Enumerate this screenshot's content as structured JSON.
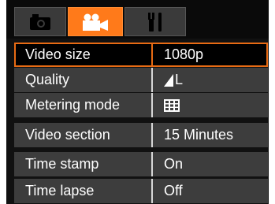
{
  "tabs": [
    {
      "icon": "camera-icon",
      "active": false
    },
    {
      "icon": "video-camera-icon",
      "active": true
    },
    {
      "icon": "tools-icon",
      "active": false
    }
  ],
  "colors": {
    "accent": "#e86b14",
    "active_tab": "#ff7a1a",
    "row_bg": "#3d3d3d",
    "screen_bg": "#111111"
  },
  "menu": {
    "items": [
      {
        "label": "Video size",
        "value": "1080p",
        "selected": true
      },
      {
        "label": "Quality",
        "value_icon": "quality-fine-icon",
        "value_text": "L"
      },
      {
        "label": "Metering mode",
        "value_icon": "metering-matrix-icon"
      },
      {
        "label": "Video section",
        "value": "15 Minutes"
      },
      {
        "label": "Time stamp",
        "value": "On"
      },
      {
        "label": "Time lapse",
        "value": "Off"
      }
    ]
  }
}
